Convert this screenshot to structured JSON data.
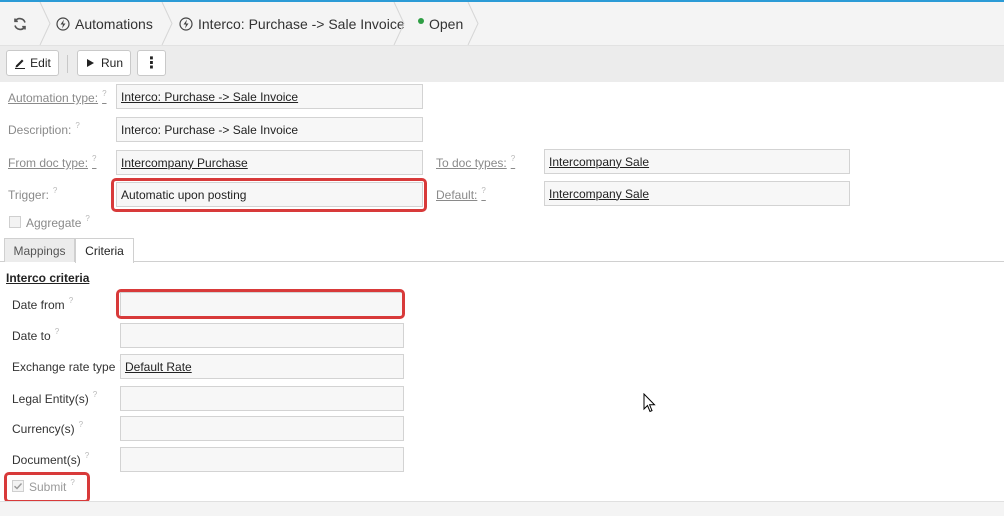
{
  "breadcrumbs": [
    {
      "label": "Automations",
      "icon": "lightning-icon"
    },
    {
      "label": "Interco: Purchase -> Sale Invoice",
      "icon": "lightning-icon"
    },
    {
      "label": "Open",
      "status_color": "#2e9e44"
    }
  ],
  "toolbar": {
    "edit_label": "Edit",
    "run_label": "Run",
    "more_label": "⋮"
  },
  "form": {
    "automation_type": {
      "label": "Automation type:",
      "value": "Interco: Purchase -> Sale Invoice"
    },
    "description": {
      "label": "Description:",
      "value": "Interco: Purchase -> Sale Invoice"
    },
    "from_doc_type": {
      "label": "From doc type:",
      "value": "Intercompany Purchase"
    },
    "to_doc_types": {
      "label": "To doc types:",
      "value": "Intercompany Sale"
    },
    "trigger": {
      "label": "Trigger:",
      "value": "Automatic upon posting"
    },
    "default": {
      "label": "Default:",
      "value": "Intercompany Sale"
    },
    "aggregate": {
      "label": "Aggregate",
      "checked": false
    }
  },
  "tabs": [
    {
      "label": "Mappings",
      "active": false
    },
    {
      "label": "Criteria",
      "active": true
    }
  ],
  "criteria": {
    "title": "Interco criteria",
    "date_from": {
      "label": "Date from",
      "value": ""
    },
    "date_to": {
      "label": "Date to",
      "value": ""
    },
    "exchange_rate_type": {
      "label": "Exchange rate type",
      "value": "Default Rate"
    },
    "legal_entities": {
      "label": "Legal Entity(s)",
      "value": ""
    },
    "currencies": {
      "label": "Currency(s)",
      "value": ""
    },
    "documents": {
      "label": "Document(s)",
      "value": ""
    },
    "submit": {
      "label": "Submit",
      "checked": true
    }
  },
  "help_marker": "?",
  "colors": {
    "accent": "#2b9bd6",
    "highlight": "#d83a3a",
    "status_open": "#2e9e44"
  }
}
